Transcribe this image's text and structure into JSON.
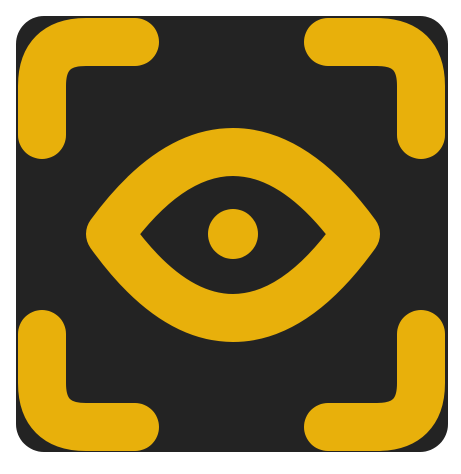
{
  "icon": {
    "name": "eye-scan-app-icon",
    "colors": {
      "background": "#ffffff",
      "tile": "#232323",
      "accent": "#e8b00b"
    }
  }
}
